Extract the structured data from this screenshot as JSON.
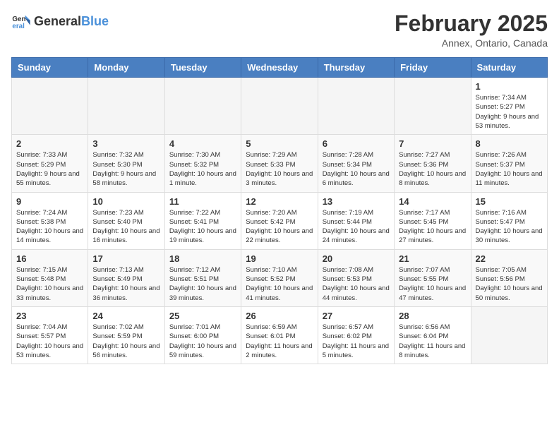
{
  "header": {
    "logo_general": "General",
    "logo_blue": "Blue",
    "title": "February 2025",
    "subtitle": "Annex, Ontario, Canada"
  },
  "weekdays": [
    "Sunday",
    "Monday",
    "Tuesday",
    "Wednesday",
    "Thursday",
    "Friday",
    "Saturday"
  ],
  "weeks": [
    [
      {
        "day": "",
        "info": ""
      },
      {
        "day": "",
        "info": ""
      },
      {
        "day": "",
        "info": ""
      },
      {
        "day": "",
        "info": ""
      },
      {
        "day": "",
        "info": ""
      },
      {
        "day": "",
        "info": ""
      },
      {
        "day": "1",
        "info": "Sunrise: 7:34 AM\nSunset: 5:27 PM\nDaylight: 9 hours and 53 minutes."
      }
    ],
    [
      {
        "day": "2",
        "info": "Sunrise: 7:33 AM\nSunset: 5:29 PM\nDaylight: 9 hours and 55 minutes."
      },
      {
        "day": "3",
        "info": "Sunrise: 7:32 AM\nSunset: 5:30 PM\nDaylight: 9 hours and 58 minutes."
      },
      {
        "day": "4",
        "info": "Sunrise: 7:30 AM\nSunset: 5:32 PM\nDaylight: 10 hours and 1 minute."
      },
      {
        "day": "5",
        "info": "Sunrise: 7:29 AM\nSunset: 5:33 PM\nDaylight: 10 hours and 3 minutes."
      },
      {
        "day": "6",
        "info": "Sunrise: 7:28 AM\nSunset: 5:34 PM\nDaylight: 10 hours and 6 minutes."
      },
      {
        "day": "7",
        "info": "Sunrise: 7:27 AM\nSunset: 5:36 PM\nDaylight: 10 hours and 8 minutes."
      },
      {
        "day": "8",
        "info": "Sunrise: 7:26 AM\nSunset: 5:37 PM\nDaylight: 10 hours and 11 minutes."
      }
    ],
    [
      {
        "day": "9",
        "info": "Sunrise: 7:24 AM\nSunset: 5:38 PM\nDaylight: 10 hours and 14 minutes."
      },
      {
        "day": "10",
        "info": "Sunrise: 7:23 AM\nSunset: 5:40 PM\nDaylight: 10 hours and 16 minutes."
      },
      {
        "day": "11",
        "info": "Sunrise: 7:22 AM\nSunset: 5:41 PM\nDaylight: 10 hours and 19 minutes."
      },
      {
        "day": "12",
        "info": "Sunrise: 7:20 AM\nSunset: 5:42 PM\nDaylight: 10 hours and 22 minutes."
      },
      {
        "day": "13",
        "info": "Sunrise: 7:19 AM\nSunset: 5:44 PM\nDaylight: 10 hours and 24 minutes."
      },
      {
        "day": "14",
        "info": "Sunrise: 7:17 AM\nSunset: 5:45 PM\nDaylight: 10 hours and 27 minutes."
      },
      {
        "day": "15",
        "info": "Sunrise: 7:16 AM\nSunset: 5:47 PM\nDaylight: 10 hours and 30 minutes."
      }
    ],
    [
      {
        "day": "16",
        "info": "Sunrise: 7:15 AM\nSunset: 5:48 PM\nDaylight: 10 hours and 33 minutes."
      },
      {
        "day": "17",
        "info": "Sunrise: 7:13 AM\nSunset: 5:49 PM\nDaylight: 10 hours and 36 minutes."
      },
      {
        "day": "18",
        "info": "Sunrise: 7:12 AM\nSunset: 5:51 PM\nDaylight: 10 hours and 39 minutes."
      },
      {
        "day": "19",
        "info": "Sunrise: 7:10 AM\nSunset: 5:52 PM\nDaylight: 10 hours and 41 minutes."
      },
      {
        "day": "20",
        "info": "Sunrise: 7:08 AM\nSunset: 5:53 PM\nDaylight: 10 hours and 44 minutes."
      },
      {
        "day": "21",
        "info": "Sunrise: 7:07 AM\nSunset: 5:55 PM\nDaylight: 10 hours and 47 minutes."
      },
      {
        "day": "22",
        "info": "Sunrise: 7:05 AM\nSunset: 5:56 PM\nDaylight: 10 hours and 50 minutes."
      }
    ],
    [
      {
        "day": "23",
        "info": "Sunrise: 7:04 AM\nSunset: 5:57 PM\nDaylight: 10 hours and 53 minutes."
      },
      {
        "day": "24",
        "info": "Sunrise: 7:02 AM\nSunset: 5:59 PM\nDaylight: 10 hours and 56 minutes."
      },
      {
        "day": "25",
        "info": "Sunrise: 7:01 AM\nSunset: 6:00 PM\nDaylight: 10 hours and 59 minutes."
      },
      {
        "day": "26",
        "info": "Sunrise: 6:59 AM\nSunset: 6:01 PM\nDaylight: 11 hours and 2 minutes."
      },
      {
        "day": "27",
        "info": "Sunrise: 6:57 AM\nSunset: 6:02 PM\nDaylight: 11 hours and 5 minutes."
      },
      {
        "day": "28",
        "info": "Sunrise: 6:56 AM\nSunset: 6:04 PM\nDaylight: 11 hours and 8 minutes."
      },
      {
        "day": "",
        "info": ""
      }
    ]
  ]
}
